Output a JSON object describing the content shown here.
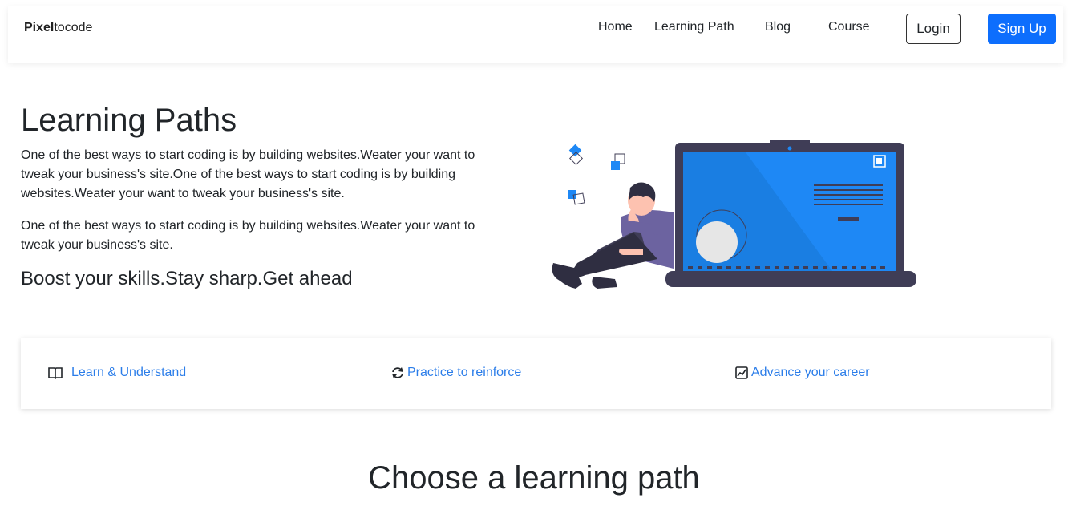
{
  "navbar": {
    "brand_bold": "Pixel",
    "brand_rest": "tocode",
    "links": [
      "Home",
      "Learning Path",
      "Blog",
      "Course"
    ],
    "login_label": "Login",
    "signup_label": "Sign Up"
  },
  "hero": {
    "title": "Learning Paths",
    "paragraph1": "One of the best ways to start coding is by building websites.Weater your want to tweak your business's site.One of the best ways to start coding is by building websites.Weater your want to tweak your business's site.",
    "paragraph2": "One of the best ways to start coding is by building websites.Weater your want to tweak your business's site.",
    "subtitle": "Boost your skills.Stay sharp.Get ahead"
  },
  "features": [
    {
      "label": "Learn & Understand",
      "icon": "book-icon"
    },
    {
      "label": "Practice to reinforce",
      "icon": "refresh-icon"
    },
    {
      "label": "Advance your career",
      "icon": "chart-icon"
    }
  ],
  "section": {
    "title": "Choose a learning path"
  },
  "colors": {
    "primary": "#0d6efd",
    "link": "#2b7de9",
    "laptop_frame": "#3f3d56",
    "screen": "#1e88f5"
  }
}
